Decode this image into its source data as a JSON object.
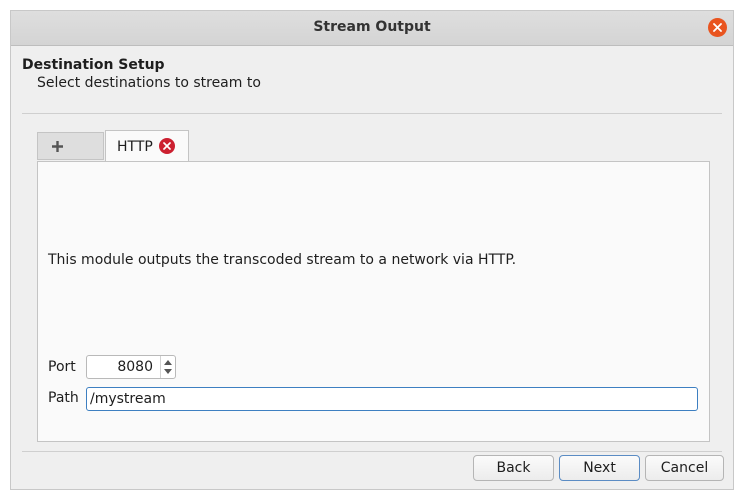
{
  "window": {
    "title": "Stream Output"
  },
  "header": {
    "heading": "Destination Setup",
    "subheading": "Select destinations to stream to"
  },
  "tabs": [
    {
      "label": "+",
      "icon": "plus-icon"
    },
    {
      "label": "HTTP",
      "icon": "tab-close-icon",
      "active": true
    }
  ],
  "http": {
    "description": "This module outputs the transcoded stream to a network via HTTP.",
    "port_label": "Port",
    "port_value": "8080",
    "path_label": "Path",
    "path_value": "/mystream"
  },
  "buttons": {
    "back": "Back",
    "next": "Next",
    "cancel": "Cancel"
  },
  "colors": {
    "close_button": "#e9541f",
    "tab_close": "#cc2030",
    "focus": "#3d7fc1"
  }
}
